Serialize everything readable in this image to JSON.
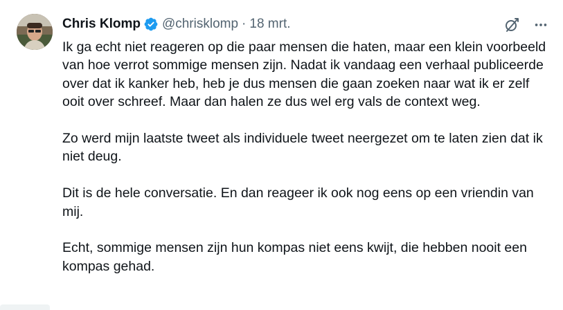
{
  "tweet": {
    "author_name": "Chris Klomp",
    "handle": "@chrisklomp",
    "separator": "·",
    "date": "18 mrt.",
    "paragraphs": [
      "Ik ga echt niet reageren op die paar mensen die haten, maar een klein voorbeeld van hoe verrot sommige mensen zijn. Nadat ik vandaag een verhaal publiceerde over dat ik kanker heb, heb je dus mensen die gaan zoeken naar wat ik er zelf ooit over schreef. Maar dan halen ze dus wel erg vals de context weg.",
      "Zo werd mijn laatste tweet als individuele tweet neergezet om te laten zien dat ik niet deug.",
      "Dit is de hele conversatie. En dan reageer ik ook nog eens op een vriendin van mij.",
      "Echt, sommige mensen zijn hun kompas niet eens kwijt, die hebben nooit een kompas gehad."
    ]
  },
  "icons": {
    "verified": "verified-badge-icon",
    "grok": "grok-slash-icon",
    "more": "more-dots-icon"
  },
  "colors": {
    "text": "#0f1419",
    "muted": "#536471",
    "verified_blue": "#1d9bf0"
  }
}
